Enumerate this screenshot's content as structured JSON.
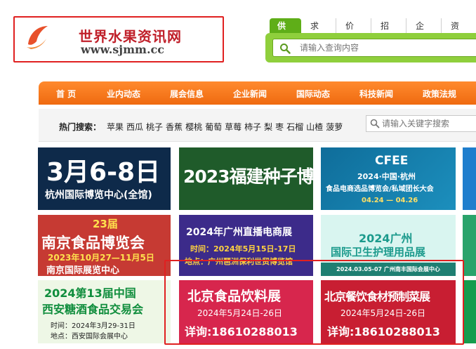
{
  "logo": {
    "name_cn": "世界水果资讯网",
    "url": "www.sjmm.cc"
  },
  "search": {
    "tabs": [
      "供应",
      "求购",
      "价格",
      "招商",
      "企业",
      "资讯"
    ],
    "placeholder": "请输入查询内容"
  },
  "nav": {
    "items": [
      "首 页",
      "业内动态",
      "展会信息",
      "企业新闻",
      "国际动态",
      "科技新闻",
      "政策法规"
    ]
  },
  "hot": {
    "label": "热门搜索：",
    "words": [
      "苹果",
      "西瓜",
      "桃子",
      "香蕉",
      "樱桃",
      "葡萄",
      "草莓",
      "柿子",
      "梨",
      "枣",
      "石榴",
      "山楂",
      "菠萝"
    ],
    "keyword_placeholder": "请输入关键字搜索"
  },
  "banners": {
    "b1": {
      "line1": "3月6-8日",
      "line2": "杭州国际博览中心(全馆)"
    },
    "b2": {
      "line1": "2023福建种子博览会"
    },
    "b3": {
      "brand": "CFEE",
      "line1": "2024·中国·杭州",
      "line2": "食品电商选品博览会/私域团长大会",
      "date": "04.24 — 04.26"
    },
    "b5": {
      "badge": "23届",
      "line1": "南京食品博览会",
      "line2": "2023年10月27—11月5日",
      "line3": "南京国际展览中心"
    },
    "b6": {
      "line1": "2024年广州直播电商展",
      "line2": "时间：2024年5月15日-17日",
      "line3": "地点：广州琶洲保利世贸博览馆"
    },
    "b7": {
      "line1": "2024广州",
      "line2": "国际卫生护理用品展",
      "line3": "2024.03.05-07 广州南丰国际会展中心"
    },
    "b9": {
      "line1": "2024第13届中国",
      "line2": "西安糖酒食品交易会",
      "line3": "时间：2024年3月29-31日",
      "line4": "地点：西安国际会展中心"
    },
    "b10": {
      "line1": "北京食品饮料展",
      "line2": "2024年5月24日-26日",
      "line3": "详询:18610288013"
    },
    "b11": {
      "line1": "北京餐饮食材预制菜展",
      "line2": "2024年5月24日-26日",
      "line3": "详询:18610288013"
    }
  },
  "colors": {
    "accent_orange": "#f07418",
    "search_green": "#8fcf3c",
    "highlight_red": "#e02020"
  }
}
